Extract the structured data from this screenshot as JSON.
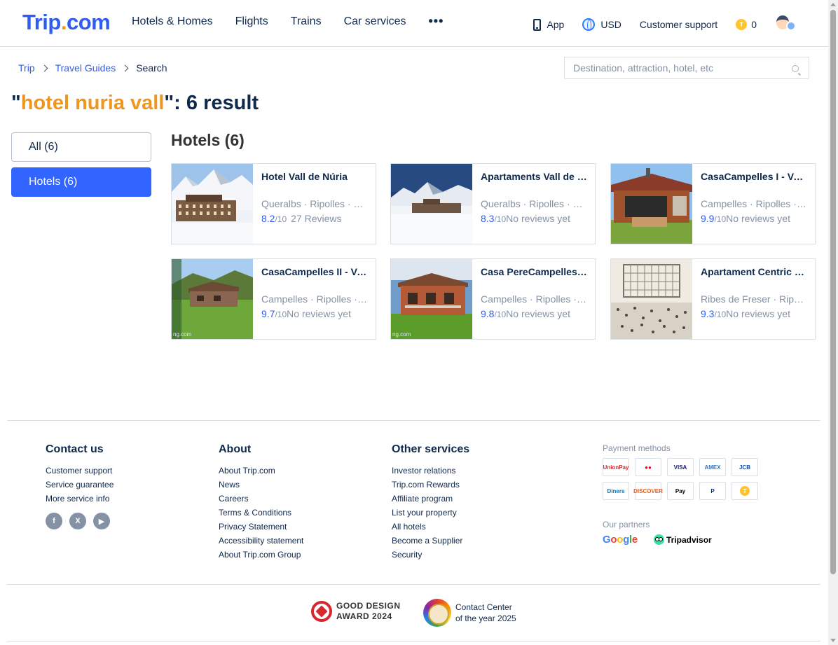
{
  "header": {
    "logo": {
      "part1": "Trip",
      "dot": ".",
      "part2": "com"
    },
    "nav": [
      "Hotels & Homes",
      "Flights",
      "Trains",
      "Car services"
    ],
    "more": "•••",
    "app_label": "App",
    "currency": "USD",
    "support": "Customer support",
    "coin_badge": "T",
    "coins": "0"
  },
  "breadcrumb": {
    "home": "Trip",
    "guides": "Travel Guides",
    "current": "Search"
  },
  "search": {
    "placeholder": "Destination, attraction, hotel, etc",
    "value": ""
  },
  "title": {
    "open_quote": "\"",
    "keyword": "hotel nuria vall",
    "suffix": "\": 6 result"
  },
  "filters": {
    "all": "All (6)",
    "hotels": "Hotels (6)"
  },
  "section_title": "Hotels (6)",
  "hotels": [
    {
      "name": "Hotel Vall de Núria",
      "location": "Queralbs · Ripolles · Catalonia",
      "score": "8.2",
      "den": "/10",
      "reviews": "27 Reviews",
      "watermark": ""
    },
    {
      "name": "Apartaments Vall de Núria",
      "location": "Queralbs · Ripolles · Catalonia",
      "score": "8.3",
      "den": "/10",
      "reviews": "No reviews yet",
      "watermark": ""
    },
    {
      "name": "CasaCampelles I - Vall de Ribes",
      "location": "Campelles · Ripolles · Catalonia",
      "score": "9.9",
      "den": "/10",
      "reviews": "No reviews yet",
      "watermark": ""
    },
    {
      "name": "CasaCampelles II - Vall de Ribes",
      "location": "Campelles · Ripolles · Catalonia",
      "score": "9.7",
      "den": "/10",
      "reviews": "No reviews yet",
      "watermark": "ng.com"
    },
    {
      "name": "Casa PereCampelles - Vall de Ribes",
      "location": "Campelles · Ripolles · Catalonia",
      "score": "9.8",
      "den": "/10",
      "reviews": "No reviews yet",
      "watermark": "ng.com"
    },
    {
      "name": "Apartament Centric Vall de Núria",
      "location": "Ribes de Freser · Ripolles · Catalonia",
      "score": "9.3",
      "den": "/10",
      "reviews": "No reviews yet",
      "watermark": ""
    }
  ],
  "footer": {
    "contact": {
      "title": "Contact us",
      "links": [
        "Customer support",
        "Service guarantee",
        "More service info"
      ]
    },
    "social": [
      "f",
      "X",
      "▶"
    ],
    "about": {
      "title": "About",
      "links": [
        "About Trip.com",
        "News",
        "Careers",
        "Terms & Conditions",
        "Privacy Statement",
        "Accessibility statement",
        "About Trip.com Group"
      ]
    },
    "other": {
      "title": "Other services",
      "links": [
        "Investor relations",
        "Trip.com Rewards",
        "Affiliate program",
        "List your property",
        "All hotels",
        "Become a Supplier",
        "Security"
      ]
    },
    "payment_title": "Payment methods",
    "payments": [
      {
        "label": "UnionPay",
        "color": "#d7282f"
      },
      {
        "label": "●●",
        "color": "#eb001b"
      },
      {
        "label": "VISA",
        "color": "#1a1f71"
      },
      {
        "label": "AMEX",
        "color": "#2e77bc"
      },
      {
        "label": "JCB",
        "color": "#0b4ea2"
      },
      {
        "label": "Diners",
        "color": "#0079be"
      },
      {
        "label": "DISCOVER",
        "color": "#e55c20"
      },
      {
        "label": "Pay",
        "color": "#000000"
      },
      {
        "label": "P",
        "color": "#003087"
      },
      {
        "label": "T",
        "color": "#ffc42b"
      }
    ],
    "partners_title": "Our partners",
    "google": {
      "g": "G",
      "o1": "o",
      "o2": "o",
      "g2": "g",
      "l": "l",
      "e": "e"
    },
    "tripadvisor": "Tripadvisor",
    "award": {
      "line1": "GOOD DESIGN",
      "line2": "AWARD 2024"
    },
    "contact_center": {
      "line1": "Contact Center",
      "line2": "of the year 2025"
    }
  },
  "colors": {
    "brand": "#2e5df0",
    "keyword": "#f0961e",
    "active_filter": "#3264ff"
  }
}
